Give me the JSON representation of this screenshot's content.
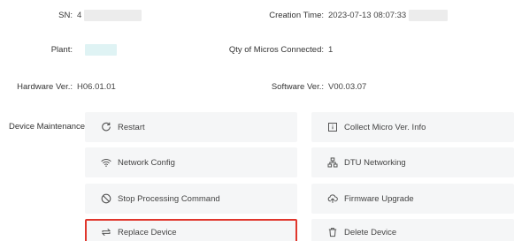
{
  "device": {
    "sn": {
      "label": "SN",
      "value": "4"
    },
    "creation_time": {
      "label": "Creation Time",
      "value": "2023-07-13 08:07:33"
    },
    "plant": {
      "label": "Plant",
      "value": ""
    },
    "qty_micros": {
      "label": "Qty of Micros Connected",
      "value": "1"
    },
    "hardware_ver": {
      "label": "Hardware Ver.",
      "value": "H06.01.01"
    },
    "software_ver": {
      "label": "Software Ver.",
      "value": "V00.03.07"
    }
  },
  "maintenance": {
    "label": "Device Maintenance",
    "actions": [
      {
        "label": "Restart",
        "icon": "restart-icon"
      },
      {
        "label": "Collect Micro Ver. Info",
        "icon": "info-box-icon"
      },
      {
        "label": "Network Config",
        "icon": "wifi-icon"
      },
      {
        "label": "DTU Networking",
        "icon": "network-tree-icon"
      },
      {
        "label": "Stop Processing Command",
        "icon": "stop-icon"
      },
      {
        "label": "Firmware Upgrade",
        "icon": "cloud-upload-icon"
      },
      {
        "label": "Replace Device",
        "icon": "replace-icon",
        "selected": true
      },
      {
        "label": "Delete Device",
        "icon": "trash-icon"
      }
    ]
  },
  "colors": {
    "selected_border": "#e0362c",
    "button_bg": "#f5f6f7"
  }
}
